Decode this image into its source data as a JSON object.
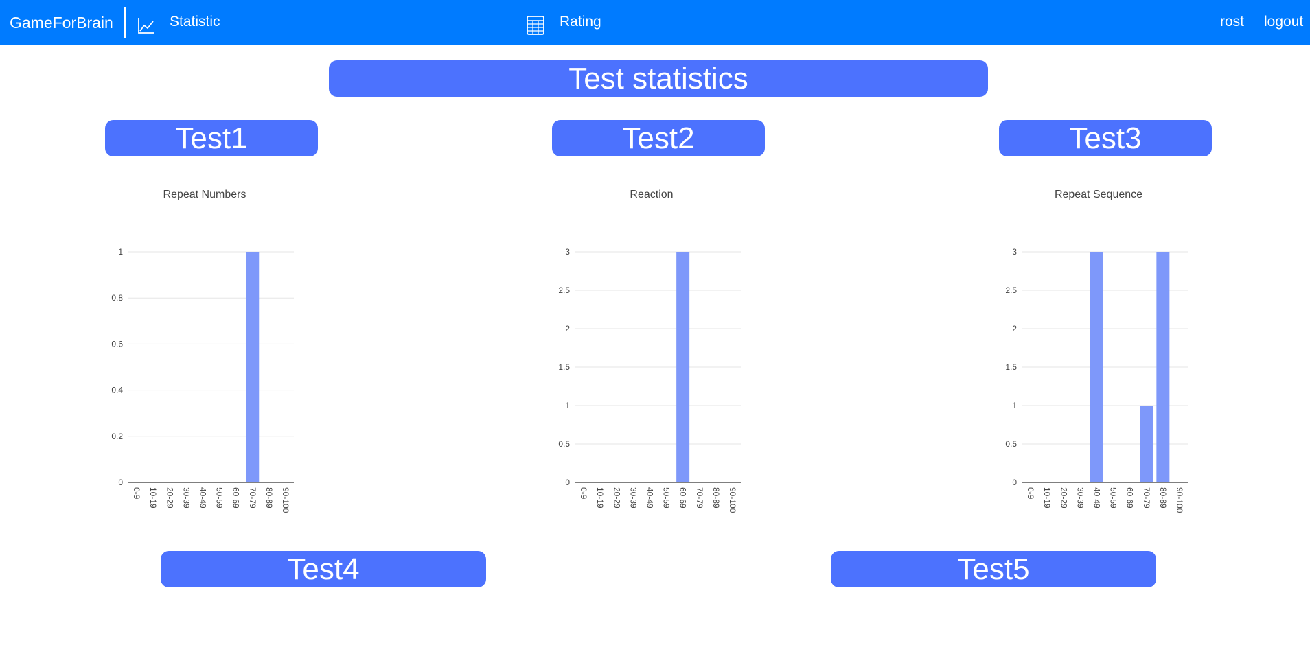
{
  "navbar": {
    "brand": "GameForBrain",
    "statistic_label": "Statistic",
    "statistic_icon": "line-chart-icon",
    "rating_label": "Rating",
    "rating_icon": "table-icon",
    "username": "rost",
    "logout_label": "logout",
    "background_color": "#007bff"
  },
  "page": {
    "title": "Test statistics",
    "pill_color": "#4c72fe"
  },
  "tests": [
    {
      "label": "Test1"
    },
    {
      "label": "Test2"
    },
    {
      "label": "Test3"
    },
    {
      "label": "Test4"
    },
    {
      "label": "Test5"
    }
  ],
  "chart_data": [
    {
      "type": "bar",
      "title": "Repeat Numbers",
      "categories": [
        "0-9",
        "10-19",
        "20-29",
        "30-39",
        "40-49",
        "50-59",
        "60-69",
        "70-79",
        "80-89",
        "90-100"
      ],
      "values": [
        0,
        0,
        0,
        0,
        0,
        0,
        0,
        1,
        0,
        0
      ],
      "ylim": [
        0,
        1
      ],
      "yticks": [
        "0",
        "0.2",
        "0.4",
        "0.6",
        "0.8",
        "1"
      ],
      "grid": true,
      "bar_color": "#7e98fa"
    },
    {
      "type": "bar",
      "title": "Reaction",
      "categories": [
        "0-9",
        "10-19",
        "20-29",
        "30-39",
        "40-49",
        "50-59",
        "60-69",
        "70-79",
        "80-89",
        "90-100"
      ],
      "values": [
        0,
        0,
        0,
        0,
        0,
        0,
        3,
        0,
        0,
        0
      ],
      "ylim": [
        0,
        3
      ],
      "yticks": [
        "0",
        "0.5",
        "1",
        "1.5",
        "2",
        "2.5",
        "3"
      ],
      "grid": true,
      "bar_color": "#7e98fa"
    },
    {
      "type": "bar",
      "title": "Repeat Sequence",
      "categories": [
        "0-9",
        "10-19",
        "20-29",
        "30-39",
        "40-49",
        "50-59",
        "60-69",
        "70-79",
        "80-89",
        "90-100"
      ],
      "values": [
        0,
        0,
        0,
        0,
        3,
        0,
        0,
        1,
        3,
        0
      ],
      "ylim": [
        0,
        3
      ],
      "yticks": [
        "0",
        "0.5",
        "1",
        "1.5",
        "2",
        "2.5",
        "3"
      ],
      "grid": true,
      "bar_color": "#7e98fa"
    }
  ]
}
